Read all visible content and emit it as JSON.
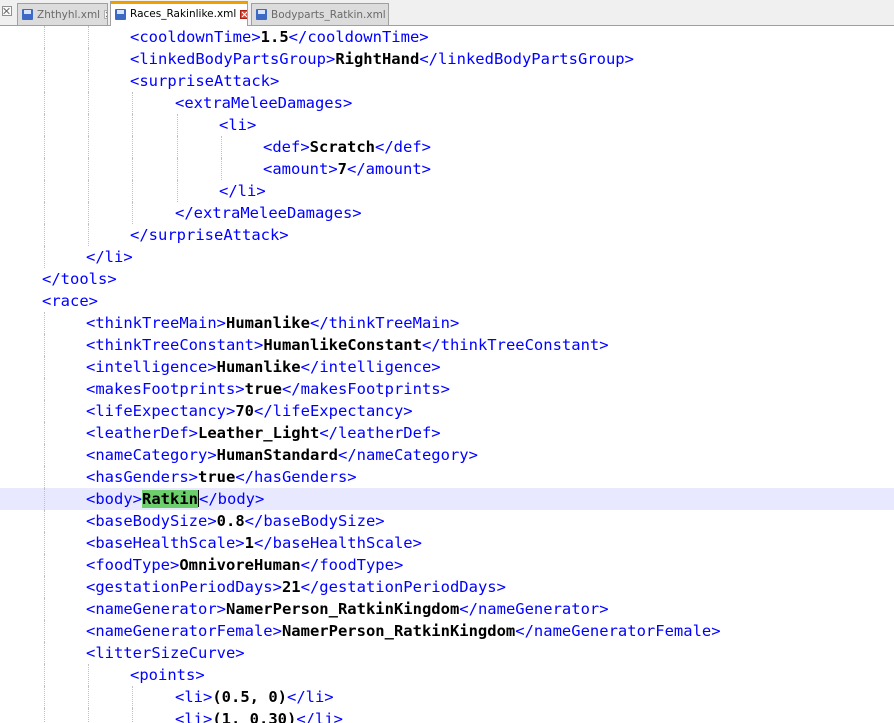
{
  "tabs": [
    {
      "name": "Zhthyhl.xml",
      "active": false
    },
    {
      "name": "Races_Rakinlike.xml",
      "active": true
    },
    {
      "name": "Bodyparts_Ratkin.xml",
      "active": false
    }
  ],
  "editor": {
    "lines": [
      {
        "indent": 3,
        "open": "<cooldownTime>",
        "value": "1.5",
        "close": "</cooldownTime>"
      },
      {
        "indent": 3,
        "open": "<linkedBodyPartsGroup>",
        "value": "RightHand",
        "close": "</linkedBodyPartsGroup>"
      },
      {
        "indent": 3,
        "open": "<surpriseAttack>",
        "value": "",
        "close": ""
      },
      {
        "indent": 4,
        "open": "<extraMeleeDamages>",
        "value": "",
        "close": ""
      },
      {
        "indent": 5,
        "open": "<li>",
        "value": "",
        "close": ""
      },
      {
        "indent": 6,
        "open": "<def>",
        "value": "Scratch",
        "close": "</def>"
      },
      {
        "indent": 6,
        "open": "<amount>",
        "value": "7",
        "close": "</amount>"
      },
      {
        "indent": 5,
        "open": "</li>",
        "value": "",
        "close": ""
      },
      {
        "indent": 4,
        "open": "</extraMeleeDamages>",
        "value": "",
        "close": ""
      },
      {
        "indent": 3,
        "open": "</surpriseAttack>",
        "value": "",
        "close": ""
      },
      {
        "indent": 2,
        "open": "</li>",
        "value": "",
        "close": ""
      },
      {
        "indent": 1,
        "open": "</tools>",
        "value": "",
        "close": ""
      },
      {
        "indent": 1,
        "open": "<race>",
        "value": "",
        "close": ""
      },
      {
        "indent": 2,
        "open": "<thinkTreeMain>",
        "value": "Humanlike",
        "close": "</thinkTreeMain>"
      },
      {
        "indent": 2,
        "open": "<thinkTreeConstant>",
        "value": "HumanlikeConstant",
        "close": "</thinkTreeConstant>"
      },
      {
        "indent": 2,
        "open": "<intelligence>",
        "value": "Humanlike",
        "close": "</intelligence>"
      },
      {
        "indent": 2,
        "open": "<makesFootprints>",
        "value": "true",
        "close": "</makesFootprints>"
      },
      {
        "indent": 2,
        "open": "<lifeExpectancy>",
        "value": "70",
        "close": "</lifeExpectancy>"
      },
      {
        "indent": 2,
        "open": "<leatherDef>",
        "value": "Leather_Light",
        "close": "</leatherDef>"
      },
      {
        "indent": 2,
        "open": "<nameCategory>",
        "value": "HumanStandard",
        "close": "</nameCategory>"
      },
      {
        "indent": 2,
        "open": "<hasGenders>",
        "value": "true",
        "close": "</hasGenders>"
      },
      {
        "indent": 2,
        "open": "<body>",
        "value": "Ratkin",
        "close": "</body>",
        "current": true,
        "highlight": true
      },
      {
        "indent": 2,
        "open": "<baseBodySize>",
        "value": "0.8",
        "close": "</baseBodySize>"
      },
      {
        "indent": 2,
        "open": "<baseHealthScale>",
        "value": "1",
        "close": "</baseHealthScale>"
      },
      {
        "indent": 2,
        "open": "<foodType>",
        "value": "OmnivoreHuman",
        "close": "</foodType>"
      },
      {
        "indent": 2,
        "open": "<gestationPeriodDays>",
        "value": "21",
        "close": "</gestationPeriodDays>"
      },
      {
        "indent": 2,
        "open": "<nameGenerator>",
        "value": "NamerPerson_RatkinKingdom",
        "close": "</nameGenerator>"
      },
      {
        "indent": 2,
        "open": "<nameGeneratorFemale>",
        "value": "NamerPerson_RatkinKingdom",
        "close": "</nameGeneratorFemale>"
      },
      {
        "indent": 2,
        "open": "<litterSizeCurve>",
        "value": "",
        "close": ""
      },
      {
        "indent": 3,
        "open": "<points>",
        "value": "",
        "close": ""
      },
      {
        "indent": 4,
        "open": "<li>",
        "value": "(0.5, 0)",
        "close": "</li>"
      },
      {
        "indent": 4,
        "open": "<li>",
        "value": "(1, 0.30)",
        "close": "</li>"
      }
    ]
  },
  "colors": {
    "tag": "#0000ff",
    "value": "#000000",
    "current_line": "#e8e8ff",
    "match_highlight": "#6ccf6c",
    "active_tab_accent": "#f0a000"
  }
}
